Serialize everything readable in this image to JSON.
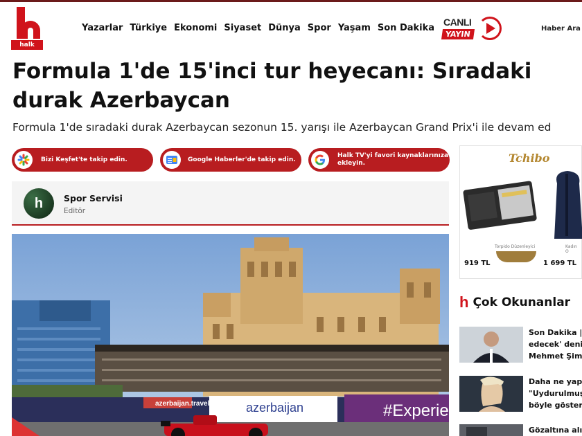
{
  "header": {
    "logo_text": "halk",
    "nav": [
      "Yazarlar",
      "Türkiye",
      "Ekonomi",
      "Siyaset",
      "Dünya",
      "Spor",
      "Yaşam",
      "Son Dakika"
    ],
    "live_top": "CANLI",
    "live_bottom": "YAYIN",
    "search_label": "Haber Ara"
  },
  "article": {
    "title": "Formula 1'de 15'inci tur heyecanı: Sıradaki durak Azerbaycan",
    "subtitle": "Formula 1'de sıradaki durak Azerbaycan sezonun 15. yarışı ile Azerbaycan Grand Prix'i ile devam ed",
    "follow_buttons": [
      {
        "label": "Bizi Keşfet'te takip edin.",
        "icon": "discover-icon"
      },
      {
        "label": "Google Haberler'de takip edin.",
        "icon": "google-news-icon"
      },
      {
        "label": "Halk TV'yi favori kaynaklarınıza ekleyin.",
        "icon": "google-icon"
      }
    ],
    "author": {
      "name": "Spor Servisi",
      "role": "Editör",
      "avatar_letter": "h"
    },
    "hero_banners": [
      "azerbaijan.travel",
      "azerbaijan",
      "#Experie"
    ]
  },
  "sidebar": {
    "ad": {
      "brand": "Tchibo",
      "product1_caption": "Torpido Düzenleyici",
      "product1_price": "919 TL",
      "product2_caption": "Kadın O",
      "product2_price": "1 699 TL"
    },
    "most_read_title": "Çok Okunanlar",
    "news": [
      {
        "lines": [
          "Son Dakika | '",
          "edecek' denild",
          "Mehmet Şimş"
        ]
      },
      {
        "lines": [
          "Daha ne yapa",
          "\"Uydurulmuş\"",
          "böyle gösterd"
        ]
      },
      {
        "lines": [
          "Gözaltına alın"
        ]
      }
    ]
  },
  "colors": {
    "brand_red": "#d0131b",
    "pill_red": "#b81d20",
    "ad_gold": "#b3862e"
  }
}
